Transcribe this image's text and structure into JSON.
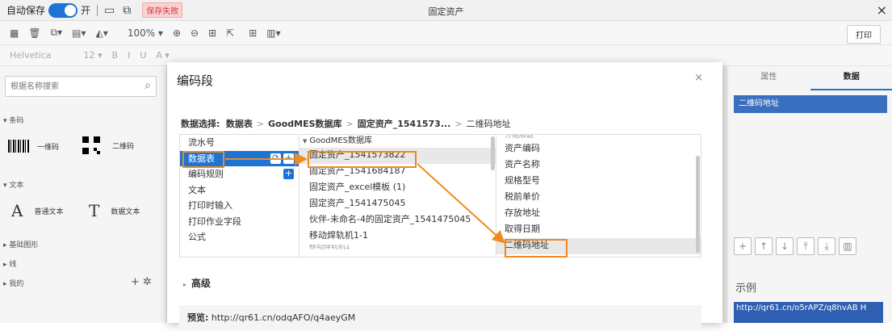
{
  "titlebar": {
    "autosave_label": "自动保存",
    "toggle_text": "开",
    "save_status": "保存失败",
    "window_title": "固定资产",
    "close_glyph": "×"
  },
  "toolbar": {
    "zoom": "100% ▾",
    "print_label": "打印",
    "font_family": "Helvetica",
    "font_size": "12 ▾",
    "bold": "B",
    "italic": "I",
    "underline": "U",
    "font_color": "A ▾"
  },
  "left_panel": {
    "search_placeholder": "根据名称搜索",
    "section_barcode": "▾ 条码",
    "barcode_label": "一维码",
    "qrcode_label": "二维码",
    "section_text": "▾ 文本",
    "normal_text_glyph": "A",
    "normal_text_label": "普通文本",
    "data_text_glyph": "T",
    "data_text_label": "数据文本",
    "section_shapes": "▸ 基础图形",
    "section_lines": "▸ 线",
    "section_mine": "▸ 我的",
    "mine_actions": "+ ✲"
  },
  "right_panel": {
    "tab_properties": "属性",
    "tab_data": "数据",
    "selected_field": "二维码地址",
    "example_label": "示例",
    "example_value": "http://qr61.cn/o5rAPZ/q8hvAB H"
  },
  "modal": {
    "title": "编码段",
    "close_glyph": "×",
    "breadcrumb": {
      "label": "数据选择:",
      "step1": "数据表",
      "step2": "GoodMES数据库",
      "step3": "固定资产_1541573...",
      "step4": "二维码地址",
      "separator": ">"
    },
    "col1_items": [
      "流水号",
      "数据表",
      "编码规则",
      "文本",
      "打印时输入",
      "打印作业字段",
      "公式"
    ],
    "col2_header": "GoodMES数据库",
    "col2_items": [
      "固定资产_1541573822",
      "固定资产_1541684187",
      "固定资产_excel模板 (1)",
      "固定资产_1541475045",
      "伙伴-未命名-4的固定资产_1541475045",
      "移动焊轨机1-1",
      "移动焊轨机1"
    ],
    "col3_items": [
      "分组顺题",
      "资产编码",
      "资产名称",
      "规格型号",
      "税前单价",
      "存放地址",
      "取得日期",
      "二维码地址"
    ],
    "advanced_label": "高级",
    "preview_label": "预览:",
    "preview_value": "http://qr61.cn/odqAFO/q4aeyGM"
  },
  "colors": {
    "accent": "#1e74d4",
    "highlight": "#f08a1e",
    "error": "#d33333"
  }
}
